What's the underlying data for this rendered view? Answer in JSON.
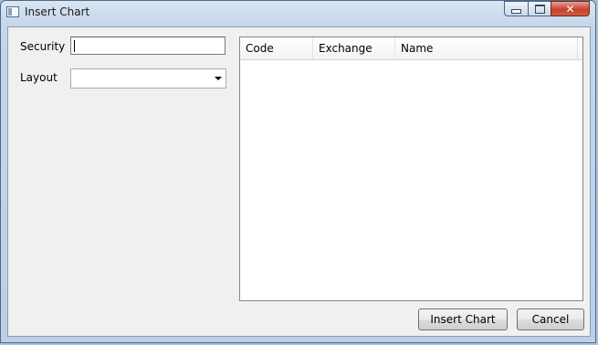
{
  "window": {
    "title": "Insert Chart",
    "caption_buttons": {
      "minimize": "minimize-icon",
      "maximize": "maximize-icon",
      "close": "✕"
    }
  },
  "form": {
    "security_label": "Security",
    "security_value": "",
    "layout_label": "Layout",
    "layout_value": ""
  },
  "table": {
    "columns": [
      "Code",
      "Exchange",
      "Name"
    ],
    "rows": []
  },
  "buttons": {
    "insert_label": "Insert Chart",
    "cancel_label": "Cancel"
  }
}
